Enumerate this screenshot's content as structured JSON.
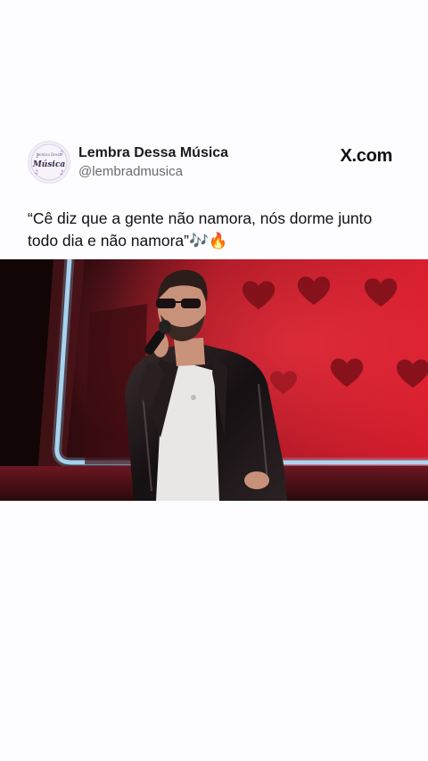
{
  "post": {
    "display_name": "Lembra Dessa Música",
    "handle": "@lembradmusica",
    "brand": "X.com",
    "text": "“Cê diz que a gente não namora, nós dorme junto todo dia e não namora”🎶🔥"
  },
  "avatar": {
    "logo_small_text": "Lembra Dessa",
    "logo_text": "Música"
  },
  "icons": {
    "brand_icon": "x-logo-icon",
    "avatar_icon": "music-notes-icon"
  },
  "colors": {
    "background": "#fdfcff",
    "name_text": "#1a1a1a",
    "handle_text": "#6b6b6b",
    "stage_red": "#d21a2a",
    "stage_blue": "#7fd3ff"
  }
}
